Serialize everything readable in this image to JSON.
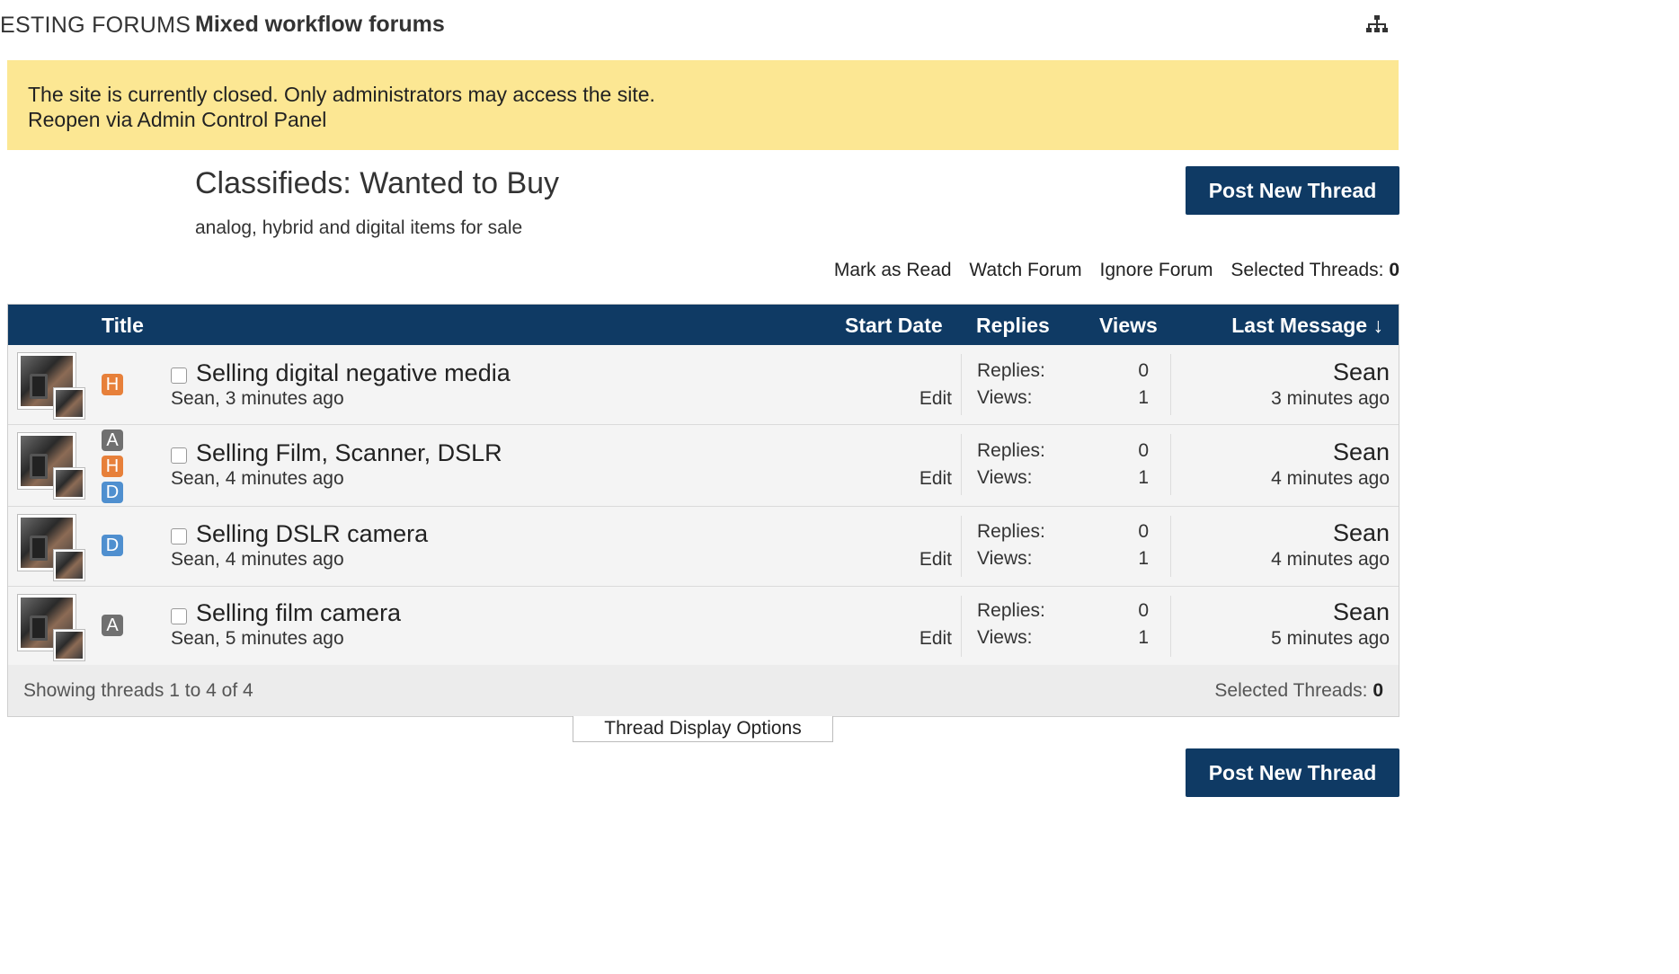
{
  "nav": {
    "previous_crumb": "ESTING FORUMS",
    "current_crumb": "Mixed workflow forums",
    "sitemap_icon": "sitemap-icon"
  },
  "notice": {
    "line1": "The site is currently closed. Only administrators may access the site.",
    "link": "Reopen via Admin Control Panel",
    "background": "#fce793"
  },
  "forum": {
    "title": "Classifieds: Wanted to Buy",
    "description": "analog, hybrid and digital items for sale",
    "post_button": "Post New Thread"
  },
  "tools": {
    "mark_read": "Mark as Read",
    "watch": "Watch Forum",
    "ignore": "Ignore Forum",
    "selected_label": "Selected Threads:",
    "selected_count": "0"
  },
  "table": {
    "header": {
      "title": "Title",
      "start_date": "Start Date",
      "replies": "Replies",
      "views": "Views",
      "last_message": "Last Message ↓"
    },
    "header_color": "#0f3a64",
    "threads": [
      {
        "prefixes": [
          "H"
        ],
        "title": "Selling digital negative media",
        "meta": "Sean, 3 minutes ago",
        "edit": "Edit",
        "replies_label": "Replies:",
        "replies": "0",
        "views_label": "Views:",
        "views": "1",
        "last_user": "Sean",
        "last_time": "3 minutes ago"
      },
      {
        "prefixes": [
          "A",
          "H",
          "D"
        ],
        "title": "Selling Film, Scanner, DSLR",
        "meta": "Sean, 4 minutes ago",
        "edit": "Edit",
        "replies_label": "Replies:",
        "replies": "0",
        "views_label": "Views:",
        "views": "1",
        "last_user": "Sean",
        "last_time": "4 minutes ago"
      },
      {
        "prefixes": [
          "D"
        ],
        "title": "Selling DSLR camera",
        "meta": "Sean, 4 minutes ago",
        "edit": "Edit",
        "replies_label": "Replies:",
        "replies": "0",
        "views_label": "Views:",
        "views": "1",
        "last_user": "Sean",
        "last_time": "4 minutes ago"
      },
      {
        "prefixes": [
          "A"
        ],
        "title": "Selling film camera",
        "meta": "Sean, 5 minutes ago",
        "edit": "Edit",
        "replies_label": "Replies:",
        "replies": "0",
        "views_label": "Views:",
        "views": "1",
        "last_user": "Sean",
        "last_time": "5 minutes ago"
      }
    ],
    "footer": {
      "showing": "Showing threads 1 to 4 of 4",
      "selected_label": "Selected Threads:",
      "selected_count": "0"
    }
  },
  "display_options": "Thread Display Options",
  "prefix_colors": {
    "H": "#e7803a",
    "A": "#707070",
    "D": "#4f8fcf"
  }
}
